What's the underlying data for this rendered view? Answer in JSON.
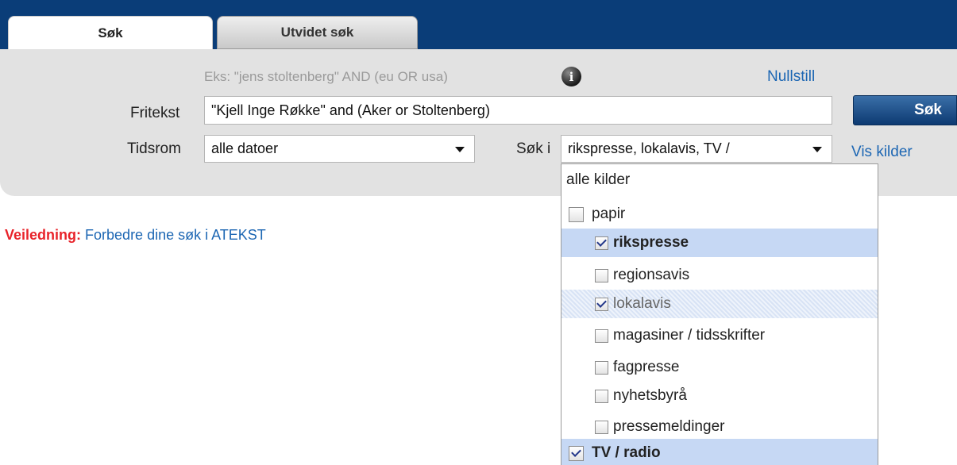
{
  "tabs": [
    {
      "label": "Søk",
      "active": true
    },
    {
      "label": "Utvidet søk",
      "active": false
    }
  ],
  "search": {
    "hint": "Eks: \"jens stoltenberg\" AND (eu OR usa)",
    "info_icon": "info-icon",
    "reset_label": "Nullstill",
    "fritekst_label": "Fritekst",
    "fritekst_value": "\"Kjell Inge Røkke\" and (Aker or Stoltenberg)",
    "tidsrom_label": "Tidsrom",
    "tidsrom_value": "alle datoer",
    "sok_i_label": "Søk i",
    "sok_i_value": "rikspresse, lokalavis, TV /",
    "search_button": "Søk",
    "vis_kilder": "Vis kilder"
  },
  "guide": {
    "label": "Veiledning:",
    "link": "Forbedre dine søk i ATEKST"
  },
  "sources": {
    "all_label": "alle kilder",
    "items": [
      {
        "label": "papir",
        "checked": false
      },
      {
        "label": "rikspresse",
        "checked": true
      },
      {
        "label": "regionsavis",
        "checked": false
      },
      {
        "label": "lokalavis",
        "checked": true
      },
      {
        "label": "magasiner / tidsskrifter",
        "checked": false
      },
      {
        "label": "fagpresse",
        "checked": false
      },
      {
        "label": "nyhetsbyrå",
        "checked": false
      },
      {
        "label": "pressemeldinger",
        "checked": false
      },
      {
        "label": "TV / radio",
        "checked": true
      }
    ]
  },
  "colors": {
    "header_blue": "#0a3d78",
    "link_blue": "#1c66b3",
    "guide_red": "#e8232a",
    "highlight": "#c6d8f4"
  }
}
